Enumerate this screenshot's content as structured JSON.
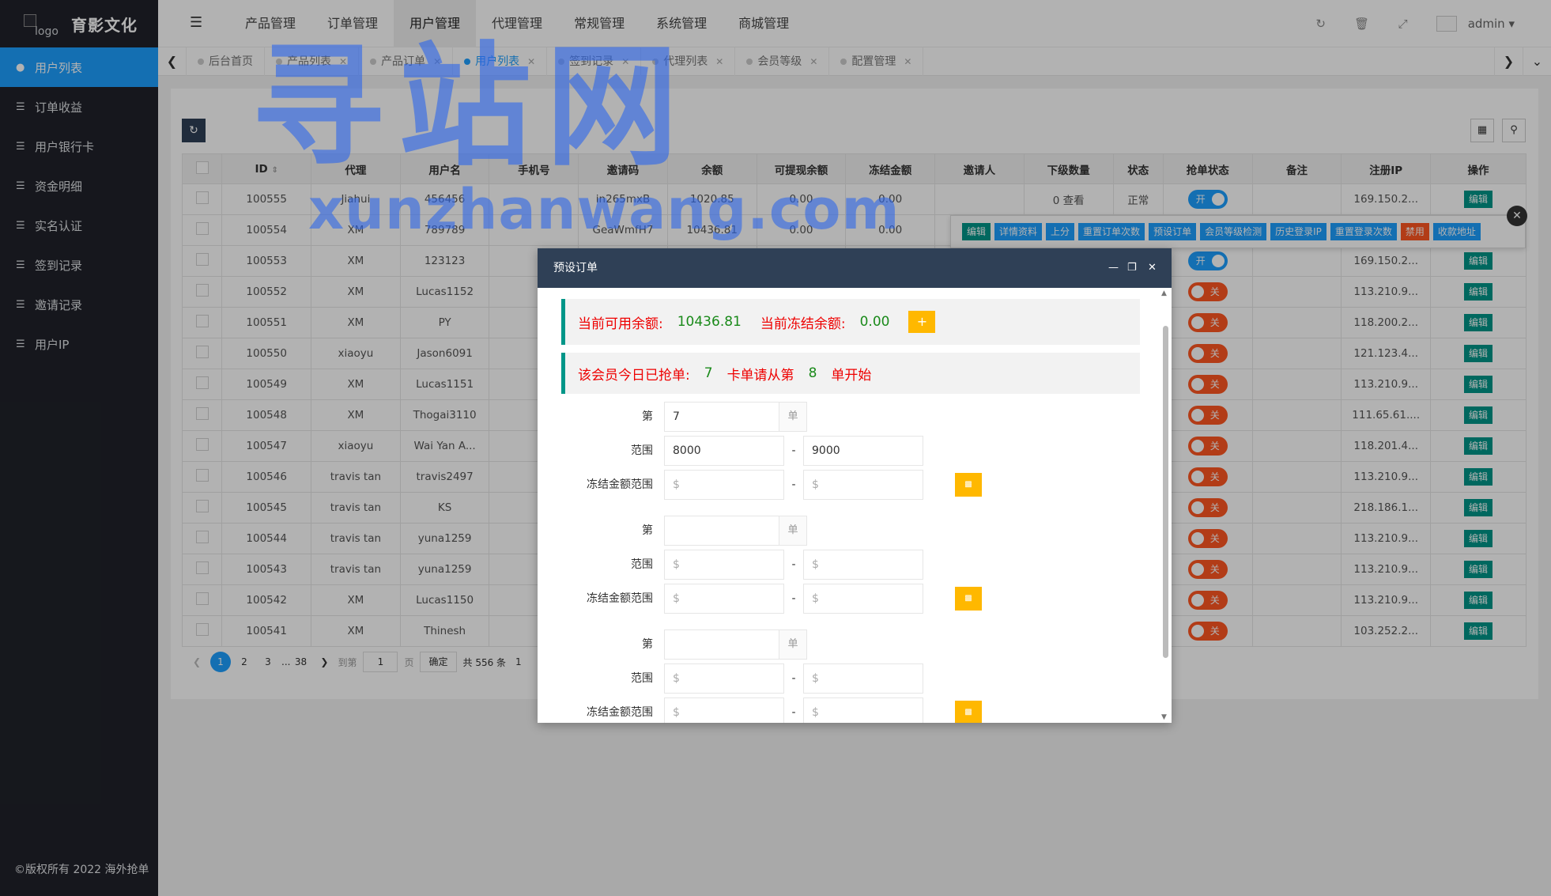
{
  "sidebar": {
    "logo_alt": "logo",
    "brand": "育影文化",
    "items": [
      {
        "label": "用户列表",
        "active": true
      },
      {
        "label": "订单收益"
      },
      {
        "label": "用户银行卡"
      },
      {
        "label": "资金明细"
      },
      {
        "label": "实名认证"
      },
      {
        "label": "签到记录"
      },
      {
        "label": "邀请记录"
      },
      {
        "label": "用户IP"
      }
    ],
    "copyright": "©版权所有 2022 海外抢单"
  },
  "header": {
    "nav": [
      "产品管理",
      "订单管理",
      "用户管理",
      "代理管理",
      "常规管理",
      "系统管理",
      "商城管理"
    ],
    "active_nav": "用户管理",
    "user": "admin"
  },
  "tabs": [
    {
      "label": "后台首页",
      "closable": false
    },
    {
      "label": "产品列表",
      "closable": true
    },
    {
      "label": "产品订单",
      "closable": true
    },
    {
      "label": "用户列表",
      "closable": true,
      "active": true
    },
    {
      "label": "签到记录",
      "closable": true
    },
    {
      "label": "代理列表",
      "closable": true
    },
    {
      "label": "会员等级",
      "closable": true
    },
    {
      "label": "配置管理",
      "closable": true
    }
  ],
  "table": {
    "columns": [
      "ID",
      "代理",
      "用户名",
      "手机号",
      "邀请码",
      "余额",
      "可提现余额",
      "冻结金额",
      "邀请人",
      "下级数量",
      "状态",
      "抢单状态",
      "备注",
      "注册IP",
      "操作"
    ],
    "rows": [
      {
        "id": "100555",
        "agent": "Jiahui",
        "user": "456456",
        "phone": "",
        "code": "in265mxB",
        "bal": "1020.85",
        "wd": "0.00",
        "frz": "0.00",
        "inviter": "",
        "sub": "0 查看",
        "status": "正常",
        "grab": "开",
        "note": "",
        "ip": "169.150.2...",
        "op": "编辑"
      },
      {
        "id": "100554",
        "agent": "XM",
        "user": "789789",
        "phone": "",
        "code": "GeaWmfH7",
        "bal": "10436.81",
        "wd": "0.00",
        "frz": "0.00",
        "inviter": "",
        "sub": "",
        "status": "",
        "grab": "",
        "note": "",
        "ip": "",
        "op": ""
      },
      {
        "id": "100553",
        "agent": "XM",
        "user": "123123",
        "grab": "开",
        "ip": "169.150.2...",
        "op": "编辑"
      },
      {
        "id": "100552",
        "agent": "XM",
        "user": "Lucas1152",
        "grab": "关",
        "ip": "113.210.9...",
        "op": "编辑"
      },
      {
        "id": "100551",
        "agent": "XM",
        "user": "PY",
        "grab": "关",
        "ip": "118.200.2...",
        "op": "编辑"
      },
      {
        "id": "100550",
        "agent": "xiaoyu",
        "user": "Jason6091",
        "grab": "关",
        "ip": "121.123.4...",
        "op": "编辑"
      },
      {
        "id": "100549",
        "agent": "XM",
        "user": "Lucas1151",
        "grab": "关",
        "ip": "113.210.9...",
        "op": "编辑"
      },
      {
        "id": "100548",
        "agent": "XM",
        "user": "Thogai3110",
        "grab": "关",
        "ip": "111.65.61....",
        "op": "编辑"
      },
      {
        "id": "100547",
        "agent": "xiaoyu",
        "user": "Wai Yan A...",
        "grab": "关",
        "ip": "118.201.4...",
        "op": "编辑"
      },
      {
        "id": "100546",
        "agent": "travis tan",
        "user": "travis2497",
        "grab": "关",
        "ip": "113.210.9...",
        "op": "编辑"
      },
      {
        "id": "100545",
        "agent": "travis tan",
        "user": "KS",
        "grab": "关",
        "ip": "218.186.1...",
        "op": "编辑"
      },
      {
        "id": "100544",
        "agent": "travis tan",
        "user": "yuna1259",
        "grab": "关",
        "ip": "113.210.9...",
        "op": "编辑"
      },
      {
        "id": "100543",
        "agent": "travis tan",
        "user": "yuna1259",
        "grab": "关",
        "ip": "113.210.9...",
        "op": "编辑"
      },
      {
        "id": "100542",
        "agent": "XM",
        "user": "Lucas1150",
        "grab": "关",
        "ip": "113.210.9...",
        "op": "编辑"
      },
      {
        "id": "100541",
        "agent": "XM",
        "user": "Thinesh",
        "grab": "关",
        "ip": "103.252.2...",
        "op": "编辑"
      }
    ]
  },
  "row_actions": [
    "编辑",
    "详情资料",
    "上分",
    "重置订单次数",
    "预设订单",
    "会员等级检测",
    "历史登录IP",
    "重置登录次数",
    "禁用",
    "收款地址"
  ],
  "pager": {
    "pages": [
      "1",
      "2",
      "3",
      "...",
      "38"
    ],
    "goto_label": "到第",
    "goto_value": "1",
    "page_unit": "页",
    "confirm": "确定",
    "total": "共 556 条",
    "tail": "1"
  },
  "watermark": {
    "line1": "寻站网",
    "line2": "xunzhanwang.com"
  },
  "modal": {
    "title": "预设订单",
    "avail_label": "当前可用余额:",
    "avail_value": "10436.81",
    "frozen_label": "当前冻结余额:",
    "frozen_value": "0.00",
    "today_label": "该会员今日已抢单:",
    "today_value": "7",
    "card_label": "卡单请从第",
    "card_value": "8",
    "card_suffix": "单开始",
    "order_label": "第",
    "order_unit": "单",
    "range_label": "范围",
    "frozen_range_label": "冻结金额范围",
    "placeholder": "$",
    "groups": [
      {
        "order": "7",
        "min": "8000",
        "max": "9000"
      },
      {
        "order": "",
        "min": "",
        "max": ""
      },
      {
        "order": "",
        "min": "",
        "max": ""
      }
    ]
  }
}
